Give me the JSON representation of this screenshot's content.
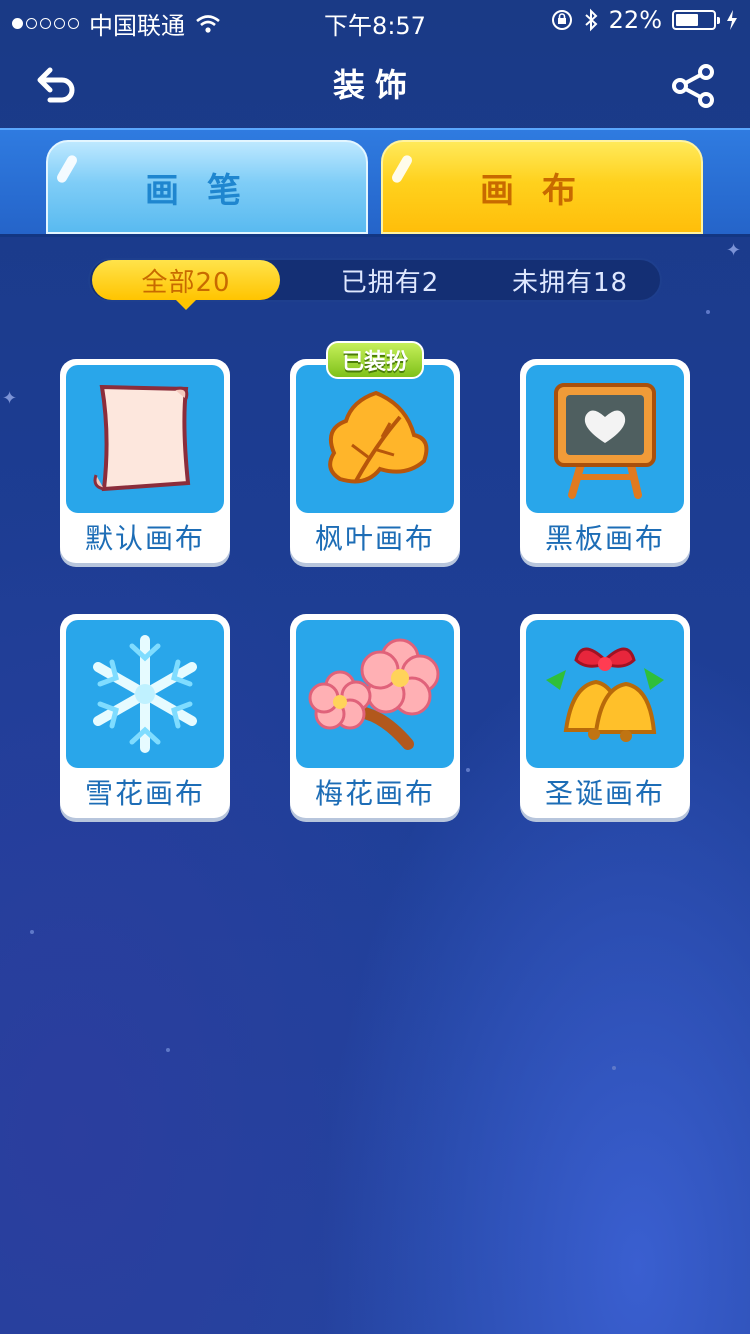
{
  "status_bar": {
    "carrier": "中国联通",
    "time": "下午8:57",
    "battery": "22%",
    "battery_level": 0.22,
    "signal_dots_filled": 1,
    "signal_dots_total": 5
  },
  "nav": {
    "title": "装饰",
    "back_icon": "back-arrow-icon",
    "share_icon": "share-icon"
  },
  "tabs": [
    {
      "label": "画笔",
      "color": "#59baf0",
      "active": false
    },
    {
      "label": "画布",
      "color": "#ffd11d",
      "active": true
    }
  ],
  "filters": [
    {
      "label": "全部20",
      "active": true
    },
    {
      "label": "已拥有2",
      "active": false
    },
    {
      "label": "未拥有18",
      "active": false
    }
  ],
  "items": [
    {
      "label": "默认画布",
      "icon": "paper-icon",
      "badge": ""
    },
    {
      "label": "枫叶画布",
      "icon": "maple-leaf-icon",
      "badge": "已装扮"
    },
    {
      "label": "黑板画布",
      "icon": "chalkboard-icon",
      "badge": ""
    },
    {
      "label": "雪花画布",
      "icon": "snowflake-icon",
      "badge": ""
    },
    {
      "label": "梅花画布",
      "icon": "plum-blossom-icon",
      "badge": ""
    },
    {
      "label": "圣诞画布",
      "icon": "christmas-bells-icon",
      "badge": ""
    }
  ],
  "colors": {
    "accent_yellow": "#ffd11d",
    "accent_blue": "#29a6ea",
    "background": "#1c3c90"
  }
}
